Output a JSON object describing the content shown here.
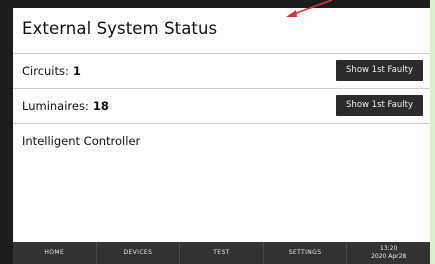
{
  "screen": {
    "title": "External System Status"
  },
  "rows": [
    {
      "label": "Circuits:",
      "value": "1",
      "button": "Show 1st Faulty"
    },
    {
      "label": "Luminaires:",
      "value": "18",
      "button": "Show 1st Faulty"
    },
    {
      "label": "Intelligent Controller"
    }
  ],
  "nav": {
    "items": [
      "HOME",
      "DEVICES",
      "TEST",
      "SETTINGS"
    ],
    "time": "13:20",
    "date": "2020 Apr28"
  },
  "colors": {
    "annotation_arrow": "#e03030",
    "nav_bg": "#323232",
    "button_bg": "#2b2b2b"
  }
}
